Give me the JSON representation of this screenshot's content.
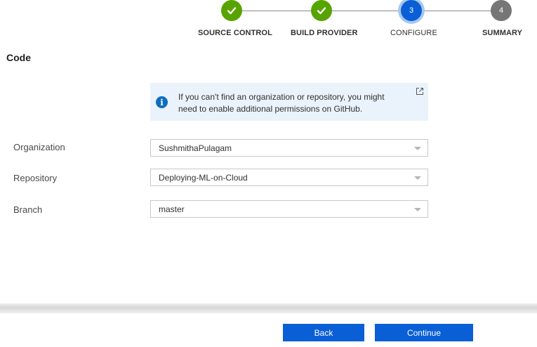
{
  "stepper": {
    "steps": [
      {
        "label": "SOURCE CONTROL",
        "state": "done",
        "icon": "check-icon"
      },
      {
        "label": "BUILD PROVIDER",
        "state": "done",
        "icon": "check-icon"
      },
      {
        "label": "CONFIGURE",
        "state": "current",
        "number": "3"
      },
      {
        "label": "SUMMARY",
        "state": "future",
        "number": "4"
      }
    ],
    "colors": {
      "done": "#57a300",
      "current": "#0a5fd6",
      "future": "#767676"
    }
  },
  "section": {
    "title": "Code"
  },
  "info": {
    "text": "If you can't find an organization or repository, you might need to enable additional permissions on GitHub.",
    "icon": "info-icon",
    "link_icon": "external-link-icon"
  },
  "form": {
    "organization": {
      "label": "Organization",
      "value": "SushmithaPulagam"
    },
    "repository": {
      "label": "Repository",
      "value": "Deploying-ML-on-Cloud"
    },
    "branch": {
      "label": "Branch",
      "value": "master"
    }
  },
  "footer": {
    "back_label": "Back",
    "continue_label": "Continue",
    "accent": "#0a5fd6"
  }
}
